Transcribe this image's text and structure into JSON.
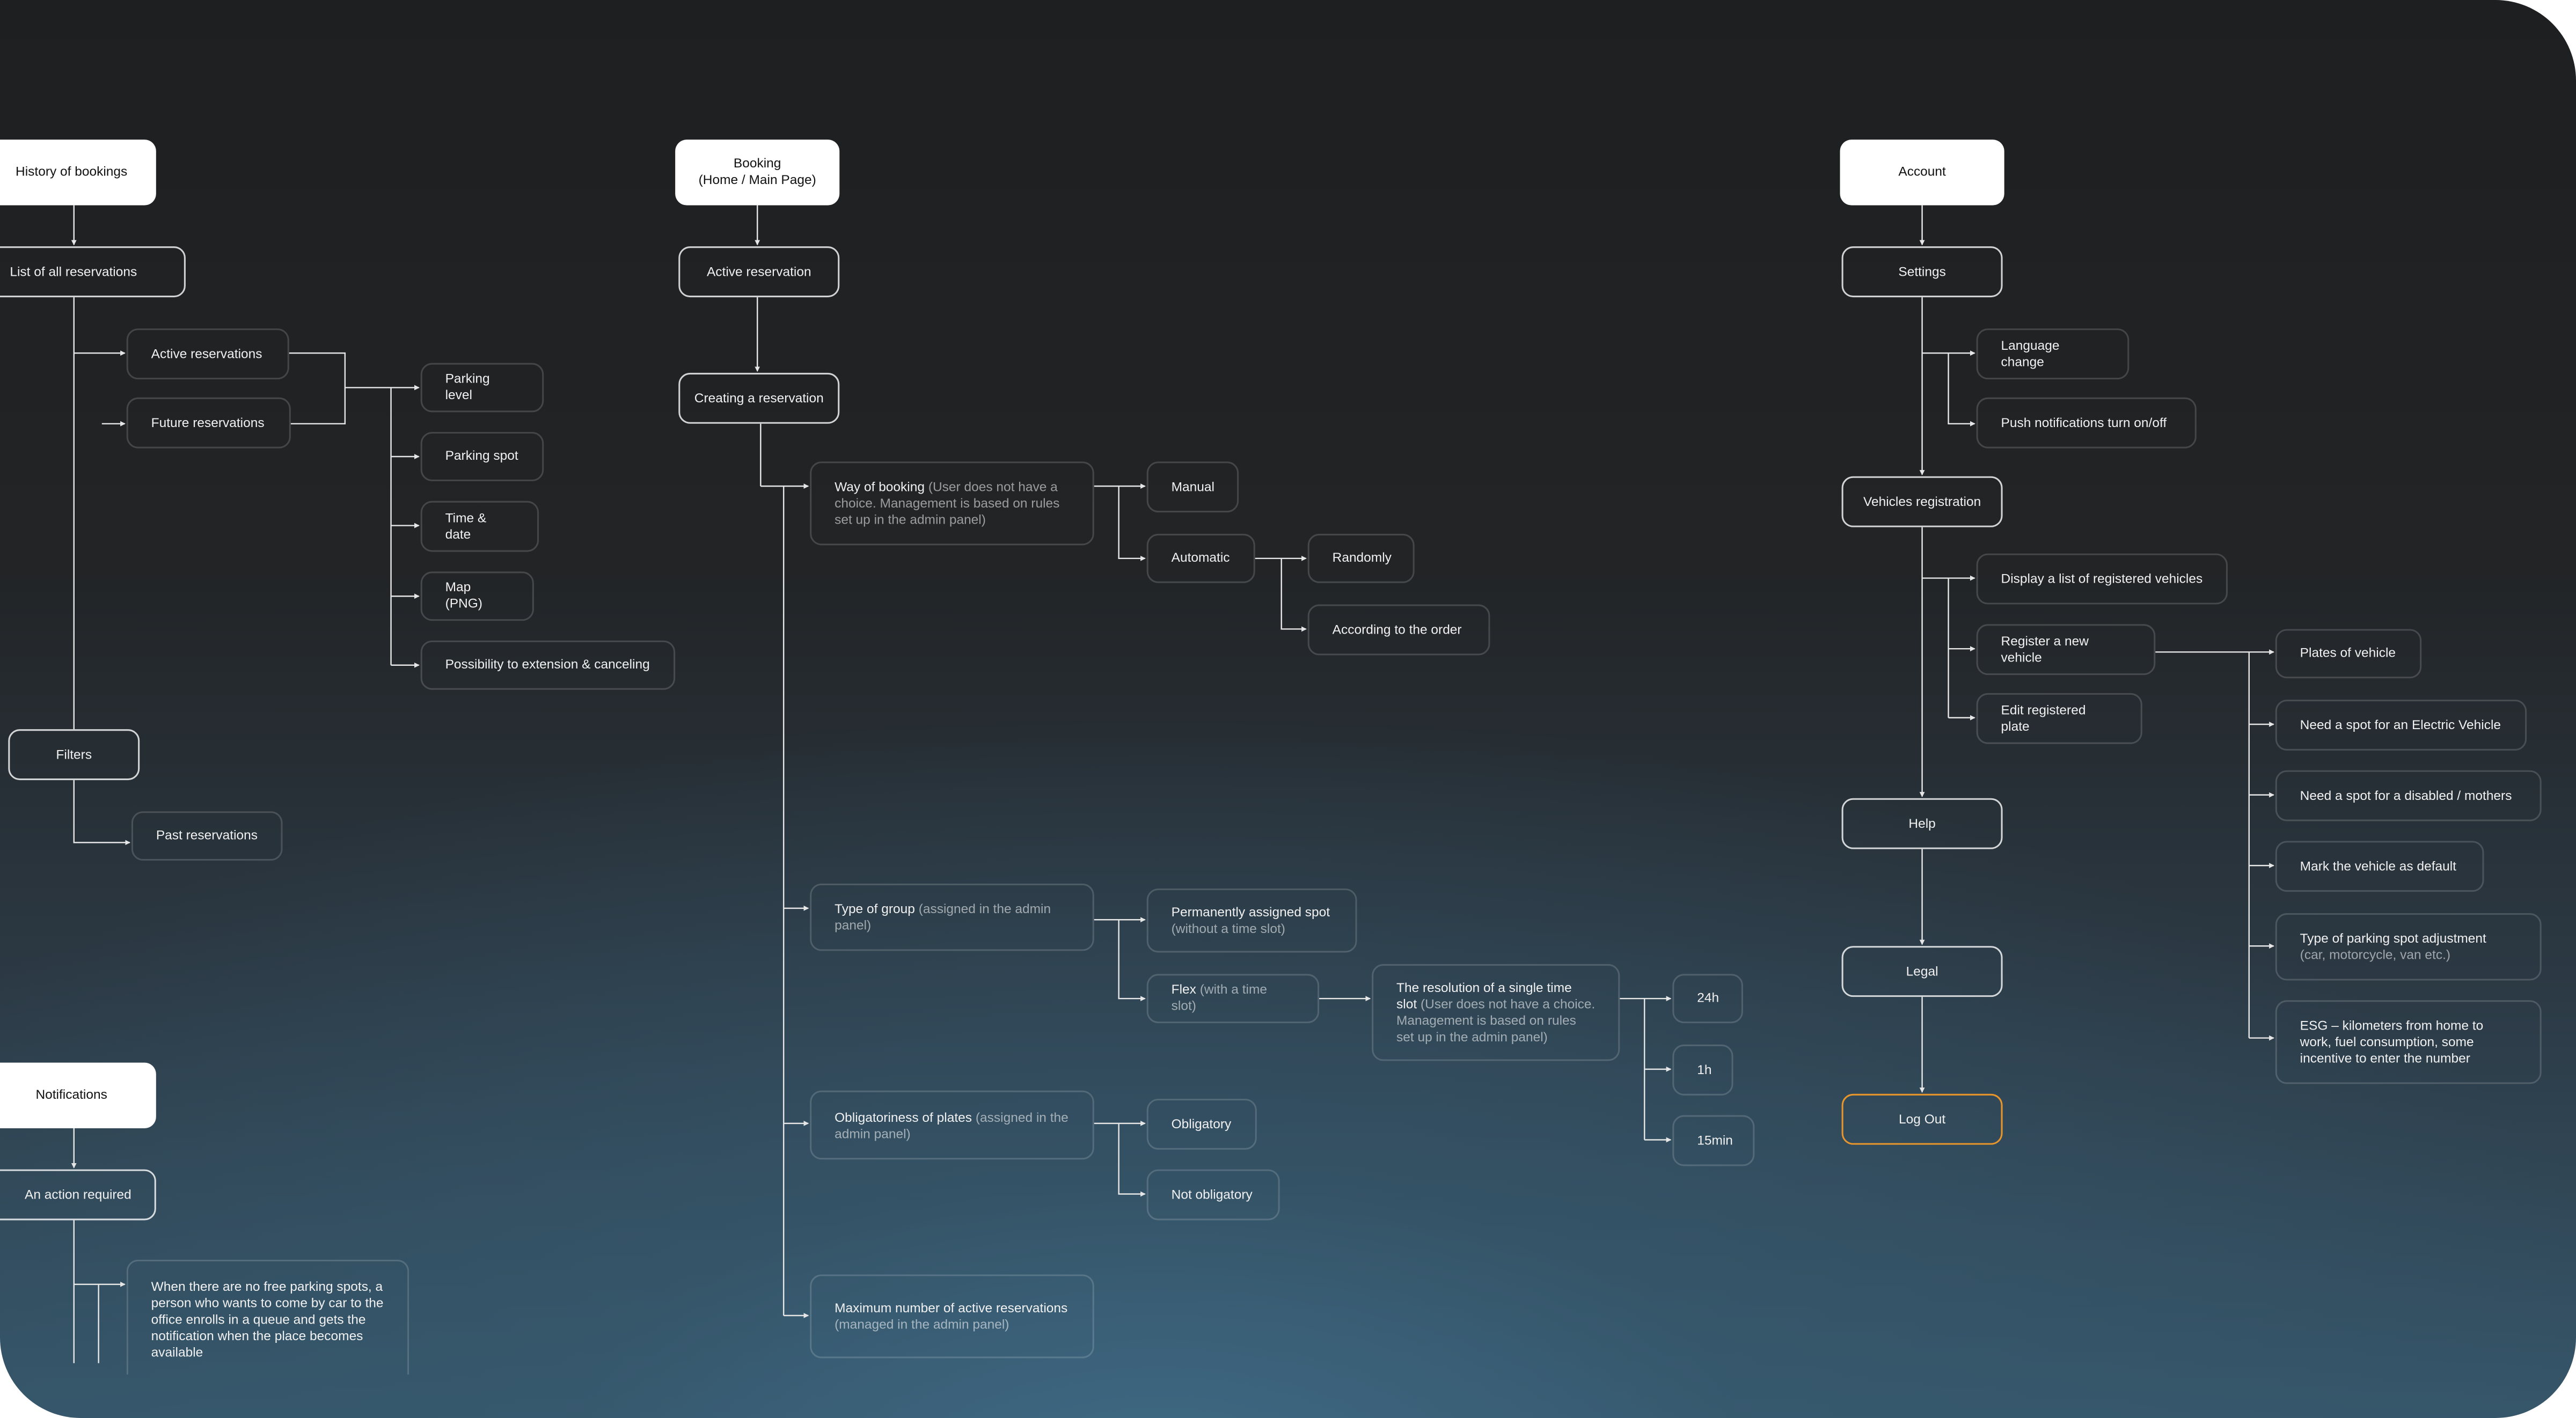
{
  "colors": {
    "accent_logout": "#e8962b",
    "background_top": "#1e1f21",
    "background_bottom": "#3f6a85"
  },
  "history": {
    "title": "History of bookings",
    "list": "List of all reservations",
    "active": "Active reservations",
    "future": "Future reservations",
    "details": [
      "Parking level",
      "Parking spot",
      "Time & date",
      "Map (PNG)",
      "Possibility to extension & canceling"
    ],
    "filters": "Filters",
    "past": "Past reservations"
  },
  "notifications": {
    "title": "Notifications",
    "action": "An action required",
    "queue": "When there are no free parking spots, a person who wants to come by car to the office enrolls in a queue and gets the notification when the place becomes available"
  },
  "booking": {
    "title": "Booking\n(Home / Main Page)",
    "title_line1": "Booking",
    "title_line2": "(Home / Main Page)",
    "active": "Active reservation",
    "creating": "Creating a reservation",
    "way": {
      "label": "Way of booking",
      "note": "(User does not have a choice. Management is based on rules set up in the admin panel)"
    },
    "manual": "Manual",
    "automatic": "Automatic",
    "randomly": "Randomly",
    "order": "According to the order",
    "group": {
      "label": "Type of group",
      "note": "(assigned in the admin panel)"
    },
    "permanent": {
      "label": "Permanently assigned spot",
      "note": "(without a time slot)"
    },
    "flex": {
      "label": "Flex",
      "note": "(with a time slot)"
    },
    "resolution": {
      "label": "The resolution of a single time slot",
      "note": "(User does not have a choice. Management is based on rules set up in the admin panel)"
    },
    "slots": [
      "24h",
      "1h",
      "15min"
    ],
    "plates": {
      "label": "Obligatoriness of plates",
      "note": "(assigned in the admin panel)"
    },
    "obligatory": "Obligatory",
    "not_obligatory": "Not obligatory",
    "max": {
      "label": "Maximum number of active reservations",
      "note": "(managed in the admin panel)"
    }
  },
  "account": {
    "title": "Account",
    "settings": "Settings",
    "language": "Language change",
    "push": "Push notifications turn on/off",
    "vehicles": "Vehicles registration",
    "display": "Display a list of registered vehicles",
    "register": "Register a new vehicle",
    "edit": "Edit registered plate",
    "vehicle_fields": [
      "Plates of vehicle",
      "Need a spot for an Electric Vehicle",
      "Need a spot for a disabled / mothers",
      "Mark the vehicle as default"
    ],
    "spot_type": {
      "label": "Type of parking spot adjustment",
      "note": "(car, motorcycle, van etc.)"
    },
    "esg": "ESG – kilometers from home to work, fuel consumption, some incentive to enter the number",
    "help": "Help",
    "legal": "Legal",
    "logout": "Log Out"
  }
}
